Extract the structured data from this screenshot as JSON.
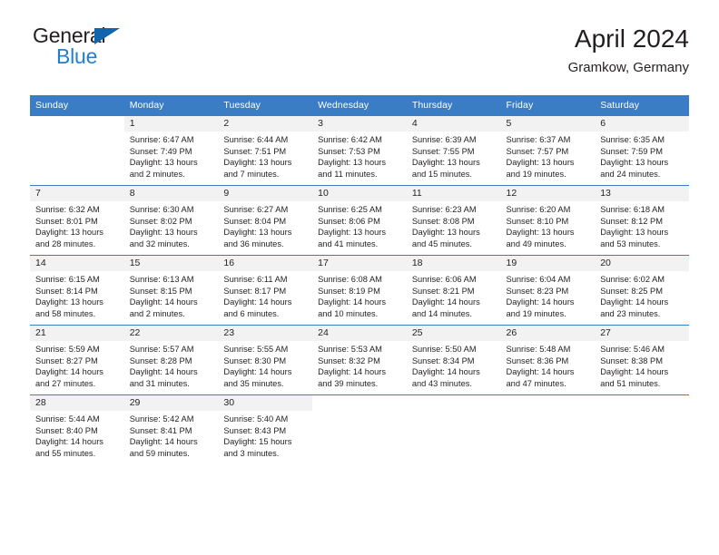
{
  "brand": {
    "line1": "General",
    "line2": "Blue",
    "flag_icon": "blue-triangle-flag-icon",
    "color_dark": "#231f20",
    "color_blue": "#1f7fd1"
  },
  "header": {
    "title": "April 2024",
    "subtitle": "Gramkow, Germany"
  },
  "theme": {
    "header_bg": "#3b7dc4",
    "header_text": "#ffffff",
    "daynum_bg": "#f2f2f2",
    "cell_border": "#3b7dc4",
    "body_text": "#231f20"
  },
  "weekdays": [
    "Sunday",
    "Monday",
    "Tuesday",
    "Wednesday",
    "Thursday",
    "Friday",
    "Saturday"
  ],
  "labels": {
    "sunrise": "Sunrise:",
    "sunset": "Sunset:",
    "daylight": "Daylight:"
  },
  "weeks": [
    [
      {
        "day": "",
        "sunrise": "",
        "sunset": "",
        "daylight": ""
      },
      {
        "day": "1",
        "sunrise": "Sunrise: 6:47 AM",
        "sunset": "Sunset: 7:49 PM",
        "daylight": "Daylight: 13 hours and 2 minutes."
      },
      {
        "day": "2",
        "sunrise": "Sunrise: 6:44 AM",
        "sunset": "Sunset: 7:51 PM",
        "daylight": "Daylight: 13 hours and 7 minutes."
      },
      {
        "day": "3",
        "sunrise": "Sunrise: 6:42 AM",
        "sunset": "Sunset: 7:53 PM",
        "daylight": "Daylight: 13 hours and 11 minutes."
      },
      {
        "day": "4",
        "sunrise": "Sunrise: 6:39 AM",
        "sunset": "Sunset: 7:55 PM",
        "daylight": "Daylight: 13 hours and 15 minutes."
      },
      {
        "day": "5",
        "sunrise": "Sunrise: 6:37 AM",
        "sunset": "Sunset: 7:57 PM",
        "daylight": "Daylight: 13 hours and 19 minutes."
      },
      {
        "day": "6",
        "sunrise": "Sunrise: 6:35 AM",
        "sunset": "Sunset: 7:59 PM",
        "daylight": "Daylight: 13 hours and 24 minutes."
      }
    ],
    [
      {
        "day": "7",
        "sunrise": "Sunrise: 6:32 AM",
        "sunset": "Sunset: 8:01 PM",
        "daylight": "Daylight: 13 hours and 28 minutes."
      },
      {
        "day": "8",
        "sunrise": "Sunrise: 6:30 AM",
        "sunset": "Sunset: 8:02 PM",
        "daylight": "Daylight: 13 hours and 32 minutes."
      },
      {
        "day": "9",
        "sunrise": "Sunrise: 6:27 AM",
        "sunset": "Sunset: 8:04 PM",
        "daylight": "Daylight: 13 hours and 36 minutes."
      },
      {
        "day": "10",
        "sunrise": "Sunrise: 6:25 AM",
        "sunset": "Sunset: 8:06 PM",
        "daylight": "Daylight: 13 hours and 41 minutes."
      },
      {
        "day": "11",
        "sunrise": "Sunrise: 6:23 AM",
        "sunset": "Sunset: 8:08 PM",
        "daylight": "Daylight: 13 hours and 45 minutes."
      },
      {
        "day": "12",
        "sunrise": "Sunrise: 6:20 AM",
        "sunset": "Sunset: 8:10 PM",
        "daylight": "Daylight: 13 hours and 49 minutes."
      },
      {
        "day": "13",
        "sunrise": "Sunrise: 6:18 AM",
        "sunset": "Sunset: 8:12 PM",
        "daylight": "Daylight: 13 hours and 53 minutes."
      }
    ],
    [
      {
        "day": "14",
        "sunrise": "Sunrise: 6:15 AM",
        "sunset": "Sunset: 8:14 PM",
        "daylight": "Daylight: 13 hours and 58 minutes."
      },
      {
        "day": "15",
        "sunrise": "Sunrise: 6:13 AM",
        "sunset": "Sunset: 8:15 PM",
        "daylight": "Daylight: 14 hours and 2 minutes."
      },
      {
        "day": "16",
        "sunrise": "Sunrise: 6:11 AM",
        "sunset": "Sunset: 8:17 PM",
        "daylight": "Daylight: 14 hours and 6 minutes."
      },
      {
        "day": "17",
        "sunrise": "Sunrise: 6:08 AM",
        "sunset": "Sunset: 8:19 PM",
        "daylight": "Daylight: 14 hours and 10 minutes."
      },
      {
        "day": "18",
        "sunrise": "Sunrise: 6:06 AM",
        "sunset": "Sunset: 8:21 PM",
        "daylight": "Daylight: 14 hours and 14 minutes."
      },
      {
        "day": "19",
        "sunrise": "Sunrise: 6:04 AM",
        "sunset": "Sunset: 8:23 PM",
        "daylight": "Daylight: 14 hours and 19 minutes."
      },
      {
        "day": "20",
        "sunrise": "Sunrise: 6:02 AM",
        "sunset": "Sunset: 8:25 PM",
        "daylight": "Daylight: 14 hours and 23 minutes."
      }
    ],
    [
      {
        "day": "21",
        "sunrise": "Sunrise: 5:59 AM",
        "sunset": "Sunset: 8:27 PM",
        "daylight": "Daylight: 14 hours and 27 minutes."
      },
      {
        "day": "22",
        "sunrise": "Sunrise: 5:57 AM",
        "sunset": "Sunset: 8:28 PM",
        "daylight": "Daylight: 14 hours and 31 minutes."
      },
      {
        "day": "23",
        "sunrise": "Sunrise: 5:55 AM",
        "sunset": "Sunset: 8:30 PM",
        "daylight": "Daylight: 14 hours and 35 minutes."
      },
      {
        "day": "24",
        "sunrise": "Sunrise: 5:53 AM",
        "sunset": "Sunset: 8:32 PM",
        "daylight": "Daylight: 14 hours and 39 minutes."
      },
      {
        "day": "25",
        "sunrise": "Sunrise: 5:50 AM",
        "sunset": "Sunset: 8:34 PM",
        "daylight": "Daylight: 14 hours and 43 minutes."
      },
      {
        "day": "26",
        "sunrise": "Sunrise: 5:48 AM",
        "sunset": "Sunset: 8:36 PM",
        "daylight": "Daylight: 14 hours and 47 minutes."
      },
      {
        "day": "27",
        "sunrise": "Sunrise: 5:46 AM",
        "sunset": "Sunset: 8:38 PM",
        "daylight": "Daylight: 14 hours and 51 minutes."
      }
    ],
    [
      {
        "day": "28",
        "sunrise": "Sunrise: 5:44 AM",
        "sunset": "Sunset: 8:40 PM",
        "daylight": "Daylight: 14 hours and 55 minutes."
      },
      {
        "day": "29",
        "sunrise": "Sunrise: 5:42 AM",
        "sunset": "Sunset: 8:41 PM",
        "daylight": "Daylight: 14 hours and 59 minutes."
      },
      {
        "day": "30",
        "sunrise": "Sunrise: 5:40 AM",
        "sunset": "Sunset: 8:43 PM",
        "daylight": "Daylight: 15 hours and 3 minutes."
      },
      {
        "day": "",
        "sunrise": "",
        "sunset": "",
        "daylight": ""
      },
      {
        "day": "",
        "sunrise": "",
        "sunset": "",
        "daylight": ""
      },
      {
        "day": "",
        "sunrise": "",
        "sunset": "",
        "daylight": ""
      },
      {
        "day": "",
        "sunrise": "",
        "sunset": "",
        "daylight": ""
      }
    ]
  ]
}
